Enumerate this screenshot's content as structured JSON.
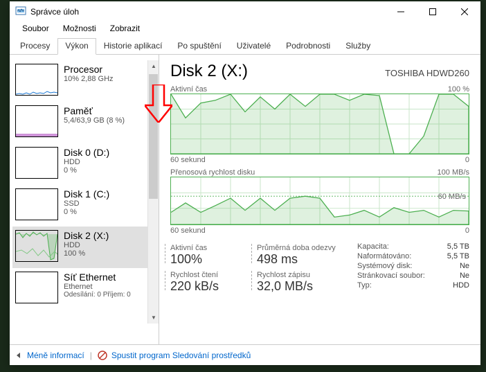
{
  "window": {
    "title": "Správce úloh"
  },
  "menu": {
    "file": "Soubor",
    "options": "Možnosti",
    "view": "Zobrazit"
  },
  "tabs": [
    "Procesy",
    "Výkon",
    "Historie aplikací",
    "Po spuštění",
    "Uživatelé",
    "Podrobnosti",
    "Služby"
  ],
  "active_tab": 1,
  "sidebar": {
    "items": [
      {
        "title": "Procesor",
        "sub": "10% 2,88 GHz",
        "sub2": ""
      },
      {
        "title": "Paměť",
        "sub": "5,4/63,9 GB (8 %)",
        "sub2": ""
      },
      {
        "title": "Disk 0 (D:)",
        "sub": "HDD",
        "sub2": "0 %"
      },
      {
        "title": "Disk 1 (C:)",
        "sub": "SSD",
        "sub2": "0 %"
      },
      {
        "title": "Disk 2 (X:)",
        "sub": "HDD",
        "sub2": "100 %"
      },
      {
        "title": "Síť Ethernet",
        "sub": "Ethernet",
        "sub2": "Odesílání: 0 Příjem: 0"
      }
    ]
  },
  "detail": {
    "title": "Disk 2 (X:)",
    "model": "TOSHIBA HDWD260",
    "chart1": {
      "label": "Aktivní čas",
      "max": "100 %",
      "xleft": "60 sekund",
      "xright": "0"
    },
    "chart2": {
      "label": "Přenosová rychlost disku",
      "max": "100 MB/s",
      "annot": "60 MB/s",
      "xleft": "60 sekund",
      "xright": "0"
    },
    "metrics": {
      "active_label": "Aktivní čas",
      "active_value": "100%",
      "resp_label": "Průměrná doba odezvy",
      "resp_value": "498 ms",
      "read_label": "Rychlost čtení",
      "read_value": "220 kB/s",
      "write_label": "Rychlost zápisu",
      "write_value": "32,0 MB/s"
    },
    "info": [
      {
        "k": "Kapacita:",
        "v": "5,5 TB"
      },
      {
        "k": "Naformátováno:",
        "v": "5,5 TB"
      },
      {
        "k": "Systémový disk:",
        "v": "Ne"
      },
      {
        "k": "Stránkovací soubor:",
        "v": "Ne"
      },
      {
        "k": "Typ:",
        "v": "HDD"
      }
    ]
  },
  "footer": {
    "less": "Méně informací",
    "resmon": "Spustit program Sledování prostředků"
  },
  "chart_data": [
    {
      "type": "line",
      "title": "Aktivní čas",
      "xlabel": "sekund",
      "ylabel": "%",
      "xlim": [
        0,
        60
      ],
      "ylim": [
        0,
        100
      ],
      "x": [
        60,
        57,
        54,
        51,
        48,
        45,
        42,
        39,
        36,
        33,
        30,
        27,
        24,
        21,
        18,
        15,
        12,
        9,
        6,
        3,
        0
      ],
      "values": [
        100,
        60,
        85,
        90,
        100,
        70,
        95,
        75,
        100,
        80,
        100,
        100,
        90,
        100,
        98,
        0,
        0,
        30,
        100,
        100,
        80
      ]
    },
    {
      "type": "line",
      "title": "Přenosová rychlost disku",
      "xlabel": "sekund",
      "ylabel": "MB/s",
      "xlim": [
        0,
        60
      ],
      "ylim": [
        0,
        100
      ],
      "x": [
        60,
        57,
        54,
        51,
        48,
        45,
        42,
        39,
        36,
        33,
        30,
        27,
        24,
        21,
        18,
        15,
        12,
        9,
        6,
        3,
        0
      ],
      "values": [
        25,
        45,
        25,
        40,
        55,
        30,
        55,
        30,
        55,
        60,
        55,
        15,
        20,
        30,
        15,
        35,
        25,
        30,
        15,
        30,
        28
      ]
    }
  ]
}
